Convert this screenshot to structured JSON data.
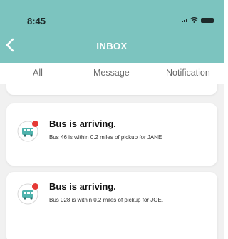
{
  "status_bar": {
    "time": "8:45"
  },
  "header": {
    "title": "INBOX"
  },
  "tabs": [
    {
      "label": "All"
    },
    {
      "label": "Message"
    },
    {
      "label": "Notification"
    }
  ],
  "notifications": [
    {
      "title": "Bus is arriving.",
      "body": "Bus 46 is within 0.2 miles of pickup for JANE"
    },
    {
      "title": "Bus is arriving.",
      "body": "Bus 028 is within 0.2 miles of pickup for JOE."
    }
  ],
  "colors": {
    "header": "#7cc4bf",
    "badge": "#e53935",
    "icon_bg": "#4fb3ad"
  }
}
